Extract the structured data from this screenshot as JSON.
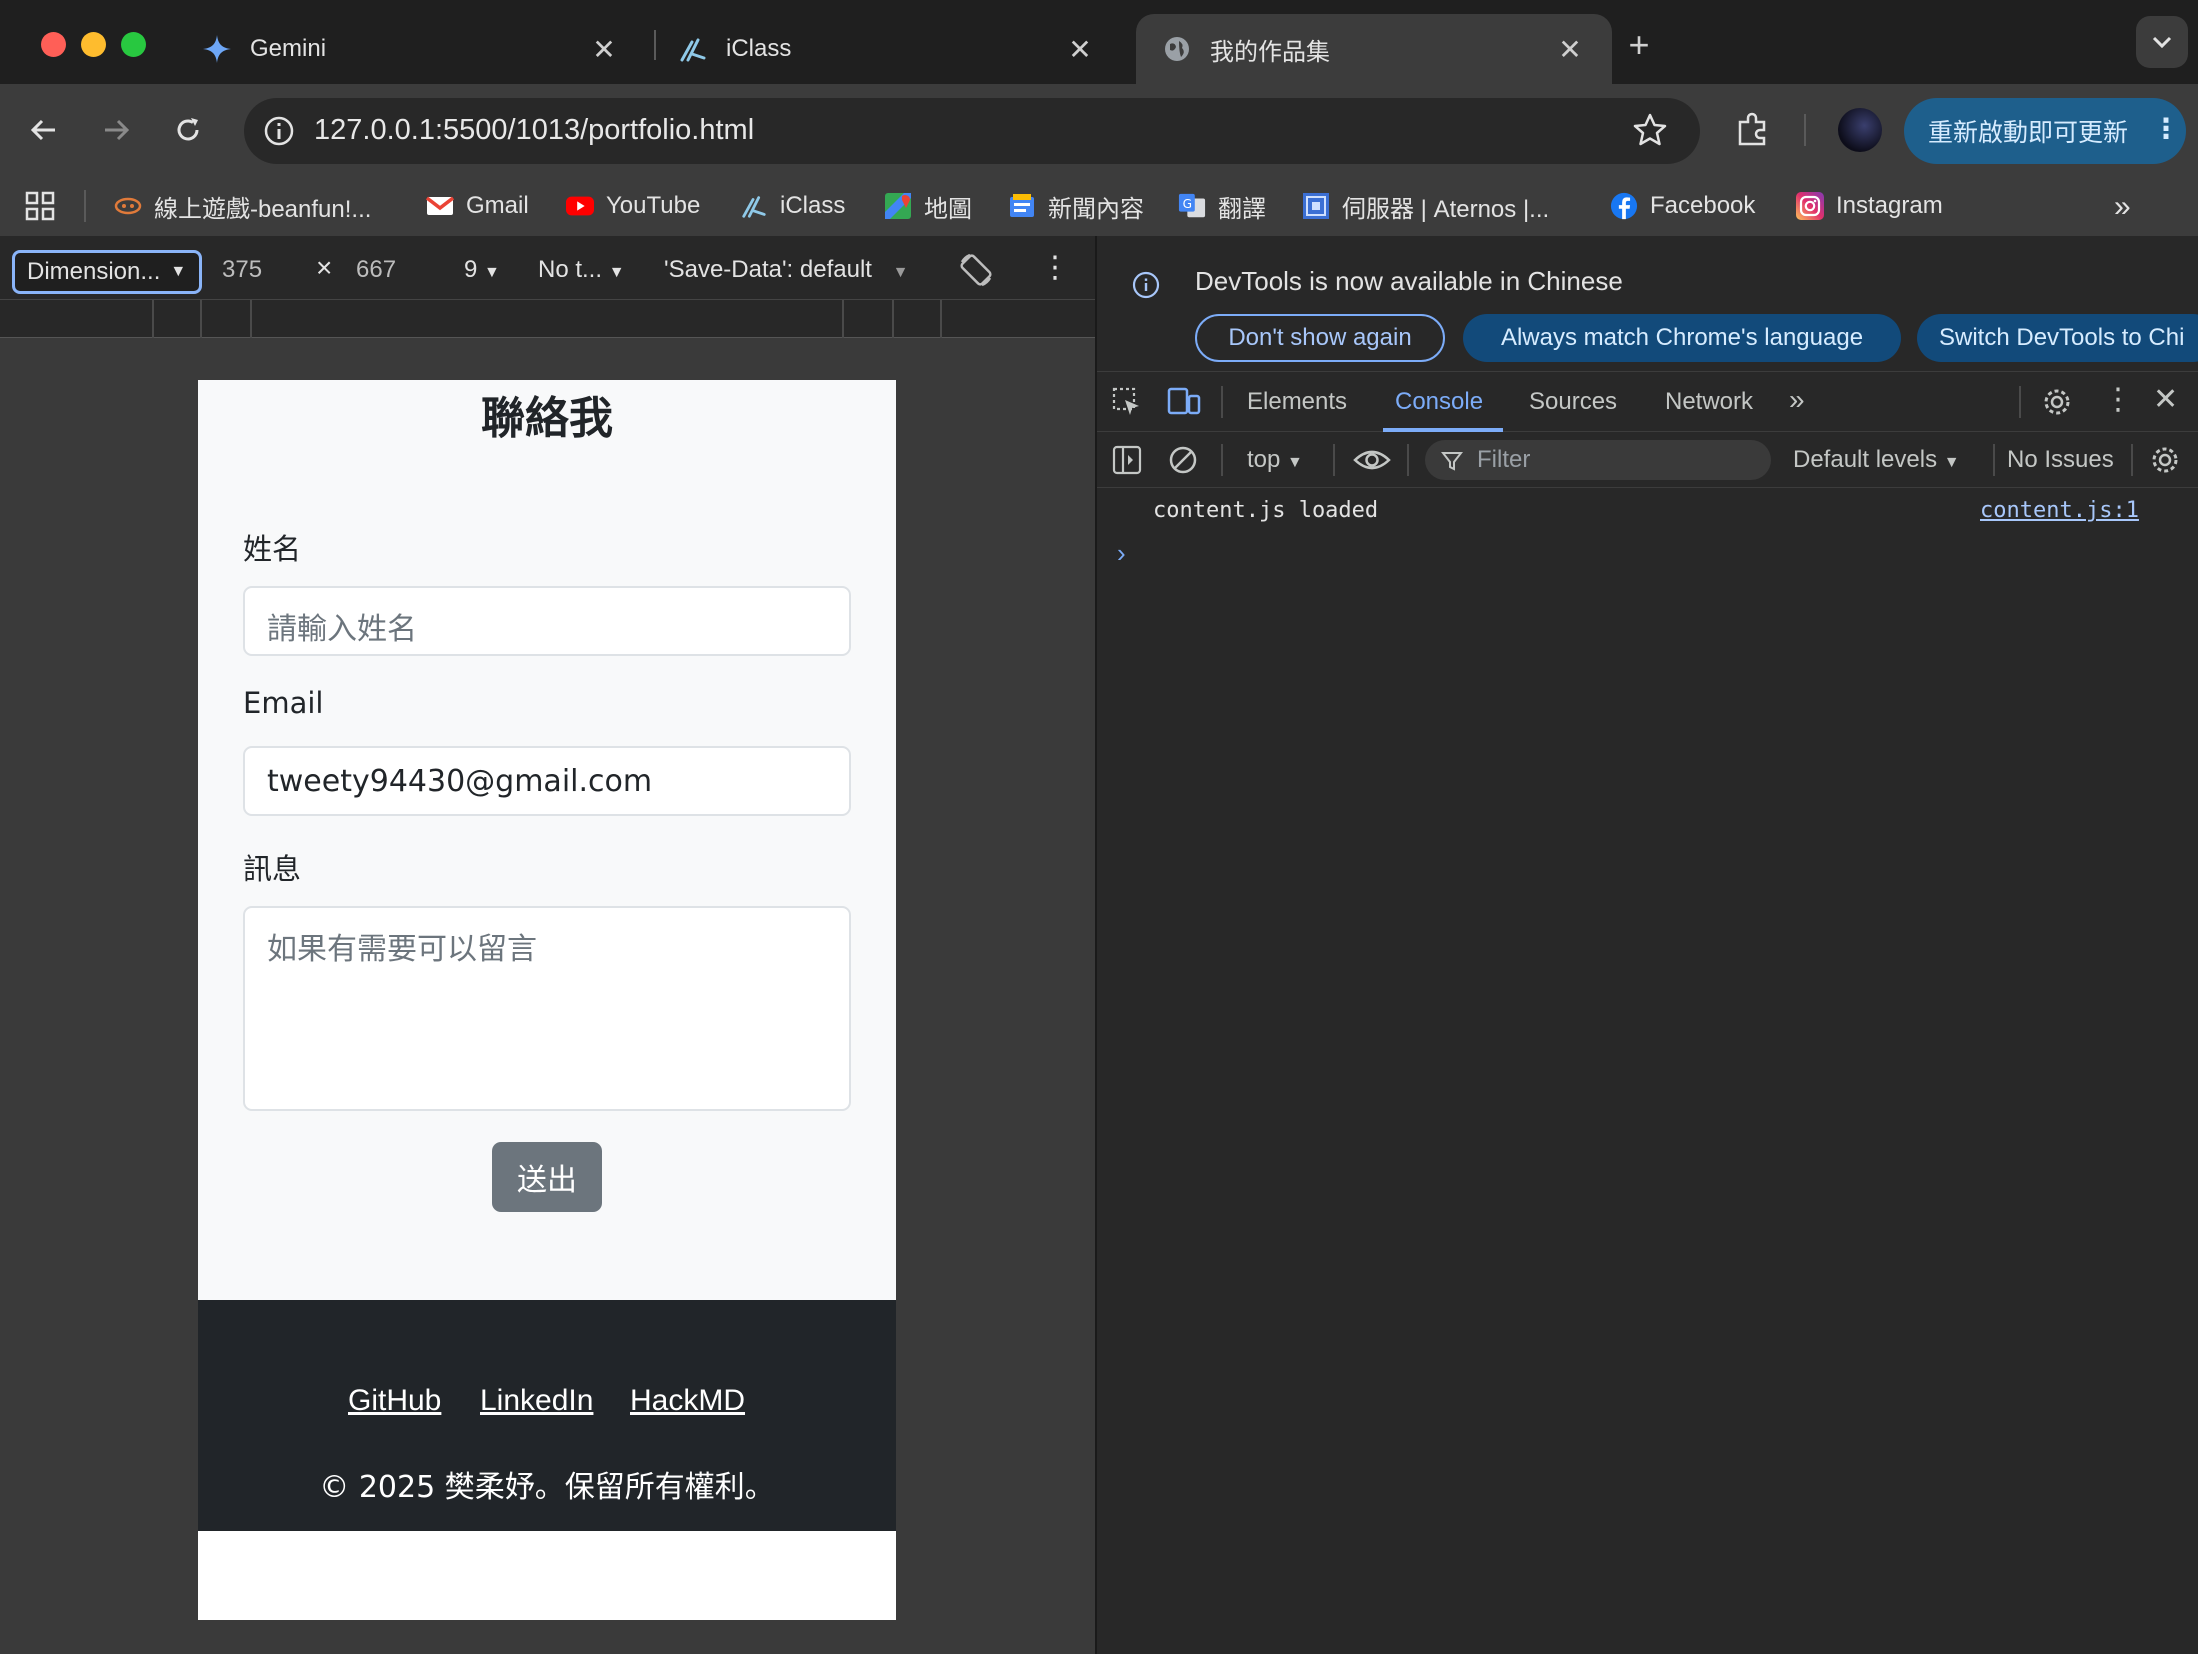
{
  "browser": {
    "tabs": [
      {
        "title": "Gemini",
        "icon": "gemini-icon"
      },
      {
        "title": "iClass",
        "icon": "iclass-icon"
      },
      {
        "title": "我的作品集",
        "icon": "globe-icon",
        "active": true
      }
    ],
    "url": "127.0.0.1:5500/1013/portfolio.html",
    "update_button": "重新啟動即可更新",
    "bookmarks": [
      {
        "label": "線上遊戲-beanfun!...",
        "icon": "beanfun-icon"
      },
      {
        "label": "Gmail",
        "icon": "gmail-icon"
      },
      {
        "label": "YouTube",
        "icon": "youtube-icon"
      },
      {
        "label": "iClass",
        "icon": "iclass-icon"
      },
      {
        "label": "地圖",
        "icon": "maps-icon"
      },
      {
        "label": "新聞內容",
        "icon": "news-icon"
      },
      {
        "label": "翻譯",
        "icon": "translate-icon"
      },
      {
        "label": "伺服器 | Aternos |...",
        "icon": "aternos-icon"
      },
      {
        "label": "Facebook",
        "icon": "facebook-icon"
      },
      {
        "label": "Instagram",
        "icon": "instagram-icon"
      }
    ]
  },
  "device_toolbar": {
    "dimension": "Dimension...",
    "width": "375",
    "times": "×",
    "height": "667",
    "zoom": "9",
    "throttle": "No t...",
    "save_data": "'Save-Data': default"
  },
  "page": {
    "title": "聯絡我",
    "name_label": "姓名",
    "name_placeholder": "請輸入姓名",
    "email_label": "Email",
    "email_value": "tweety94430@gmail.com",
    "message_label": "訊息",
    "message_placeholder": "如果有需要可以留言",
    "submit": "送出",
    "footer_links": [
      "GitHub",
      "LinkedIn",
      "HackMD"
    ],
    "copyright": "© 2025 樊柔妤。保留所有權利。"
  },
  "devtools": {
    "infobar_message": "DevTools is now available in Chinese",
    "infobar_buttons": [
      "Don't show again",
      "Always match Chrome's language",
      "Switch DevTools to Chi"
    ],
    "panel_tabs": [
      "Elements",
      "Console",
      "Sources",
      "Network"
    ],
    "active_tab": "Console",
    "context": "top",
    "filter_placeholder": "Filter",
    "levels": "Default levels",
    "issues": "No Issues",
    "log_message": "content.js loaded",
    "log_source": "content.js:1",
    "prompt": "›"
  },
  "colors": {
    "accent": "#7cacf8",
    "update_bg": "#1e5f8c",
    "footer_bg": "#212529",
    "submit_bg": "#6c757d"
  }
}
